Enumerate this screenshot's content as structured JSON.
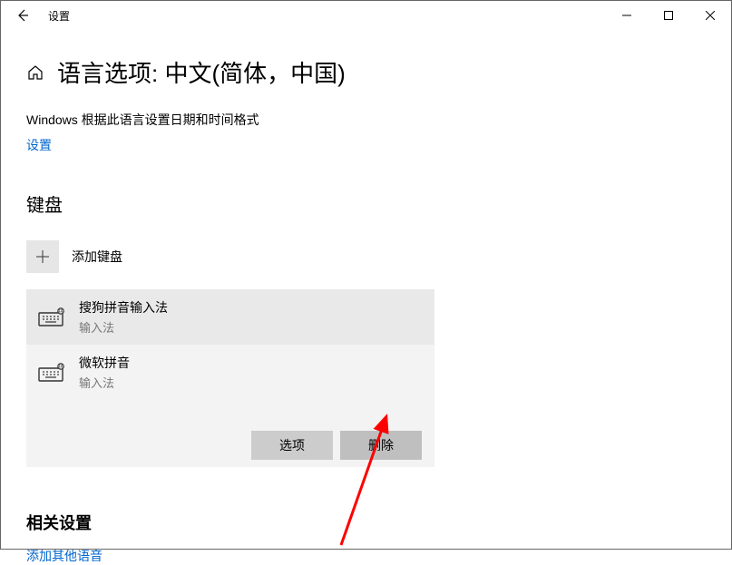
{
  "titlebar": {
    "title": "设置"
  },
  "header": {
    "title": "语言选项: 中文(简体，中国)"
  },
  "description": "Windows 根据此语言设置日期和时间格式",
  "settings_link": "设置",
  "keyboard": {
    "section_title": "键盘",
    "add_label": "添加键盘",
    "items": [
      {
        "name": "搜狗拼音输入法",
        "subtitle": "输入法"
      },
      {
        "name": "微软拼音",
        "subtitle": "输入法"
      }
    ],
    "actions": {
      "options": "选项",
      "remove": "删除"
    }
  },
  "related": {
    "title": "相关设置",
    "link": "添加其他语音"
  }
}
